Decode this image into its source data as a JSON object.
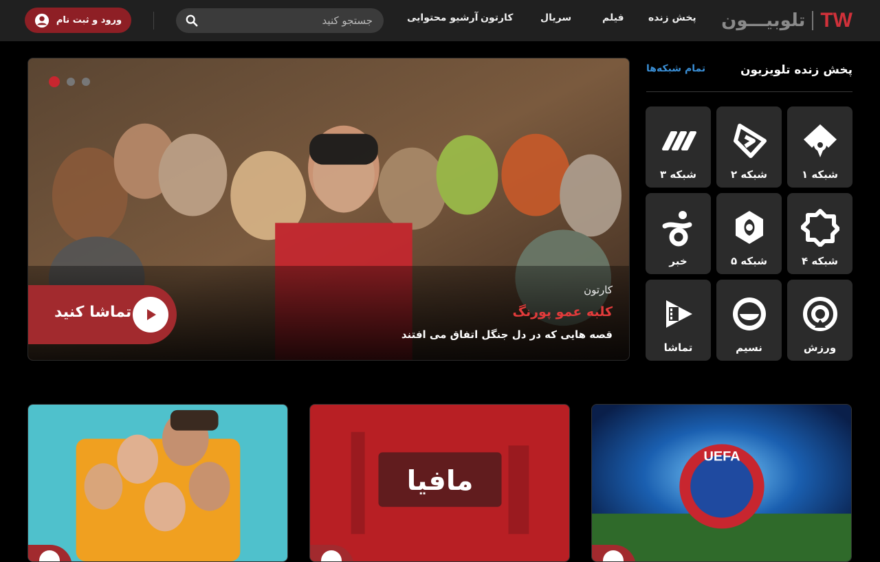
{
  "header": {
    "logo_text": "تلوبیـــون",
    "logo_mark": "TW",
    "nav": [
      {
        "label": "پخش زنده"
      },
      {
        "label": "فیلم"
      },
      {
        "label": "سریال"
      },
      {
        "label": "کارتون"
      },
      {
        "label": "آرشیو محتوایی"
      }
    ],
    "search_placeholder": "جستجو کنید",
    "login_label": "ورود و ثبت نام"
  },
  "hero": {
    "category": "کارتون",
    "title": "کلبه عمو پورنگ",
    "description": "قصه هایی که در دل جنگل اتفاق می افتند",
    "watch_label": "تماشا کنید",
    "slide_index": 1,
    "slide_count": 3
  },
  "live": {
    "title": "پخش زنده تلویزیون",
    "all_channels": "تمام شبکه‌ها",
    "channels": [
      {
        "label": "شبکه ۱",
        "icon": "channel-1-icon"
      },
      {
        "label": "شبکه ۲",
        "icon": "channel-2-icon"
      },
      {
        "label": "شبکه ۳",
        "icon": "channel-3-icon"
      },
      {
        "label": "شبکه ۴",
        "icon": "channel-4-icon"
      },
      {
        "label": "شبکه ۵",
        "icon": "channel-5-icon"
      },
      {
        "label": "خبر",
        "icon": "news-channel-icon"
      },
      {
        "label": "ورزش",
        "icon": "sport-channel-icon"
      },
      {
        "label": "نسیم",
        "icon": "nasim-channel-icon"
      },
      {
        "label": "تماشا",
        "icon": "tamasha-channel-icon"
      }
    ]
  },
  "cards": [
    {
      "name": "uefa-card",
      "logo_text": "UEFA"
    },
    {
      "name": "mafia-card",
      "logo_text": "مافیا"
    },
    {
      "name": "series-card",
      "logo_text": ""
    }
  ],
  "colors": {
    "accent": "#a22a2e",
    "link": "#3a8fd6",
    "header_bg": "#202020",
    "tile_bg": "#2b2b2b"
  }
}
